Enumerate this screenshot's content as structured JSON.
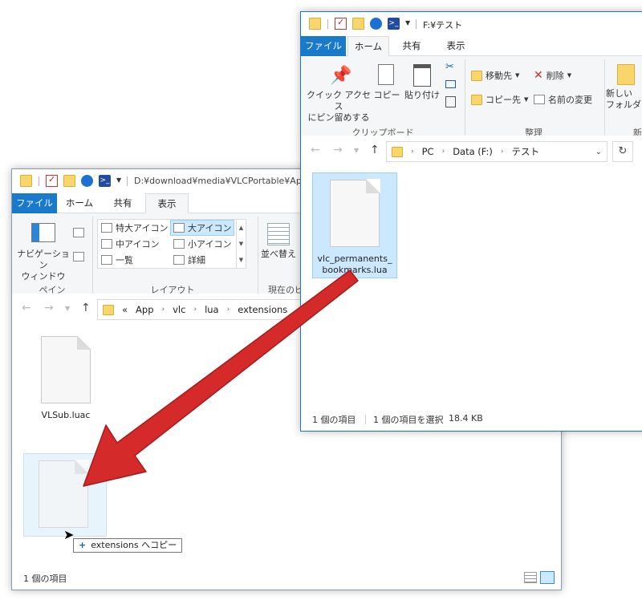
{
  "back_window": {
    "title_path": "D:¥download¥media¥VLCPortable¥App",
    "tabs": [
      "ファイル",
      "ホーム",
      "共有",
      "表示"
    ],
    "ribbon": {
      "nav_pane_label": "ナビゲーション\nウィンドウ",
      "pane_group": "ペイン",
      "layout_group": "レイアウト",
      "layout_items": [
        "特大アイコン",
        "大アイコン",
        "中アイコン",
        "小アイコン",
        "一覧",
        "詳細"
      ],
      "sort_label": "並べ替え",
      "current_view_label": "現在のビ"
    },
    "breadcrumb": [
      "App",
      "vlc",
      "lua",
      "extensions"
    ],
    "breadcrumb_prefix": "«",
    "files": [
      {
        "name": "VLSub.luac"
      }
    ],
    "status": "1 個の項目",
    "drag_tooltip": "extensions へコピー",
    "drag_plus": "+"
  },
  "front_window": {
    "title_path": "F:¥テスト",
    "tabs": [
      "ファイル",
      "ホーム",
      "共有",
      "表示"
    ],
    "ribbon": {
      "pin_label": "クイック アクセス\nにピン留めする",
      "copy_label": "コピー",
      "paste_label": "貼り付け",
      "clipboard_group": "クリップボード",
      "move_to": "移動先",
      "copy_to": "コピー先",
      "delete": "削除",
      "rename": "名前の変更",
      "organize_group": "整理",
      "new_folder": "新しい\nフォルダー",
      "new_group": "新規"
    },
    "breadcrumb": [
      "PC",
      "Data (F:)",
      "テスト"
    ],
    "files": [
      {
        "name": "vlc_permanents_\nbookmarks.lua"
      }
    ],
    "status": "1 個の項目",
    "status_selected": "1 個の項目を選択",
    "status_size": "18.4 KB"
  },
  "colors": {
    "file_tab": "#1979ca",
    "arrow": "#d42a2a",
    "selection": "#cce8ff"
  }
}
